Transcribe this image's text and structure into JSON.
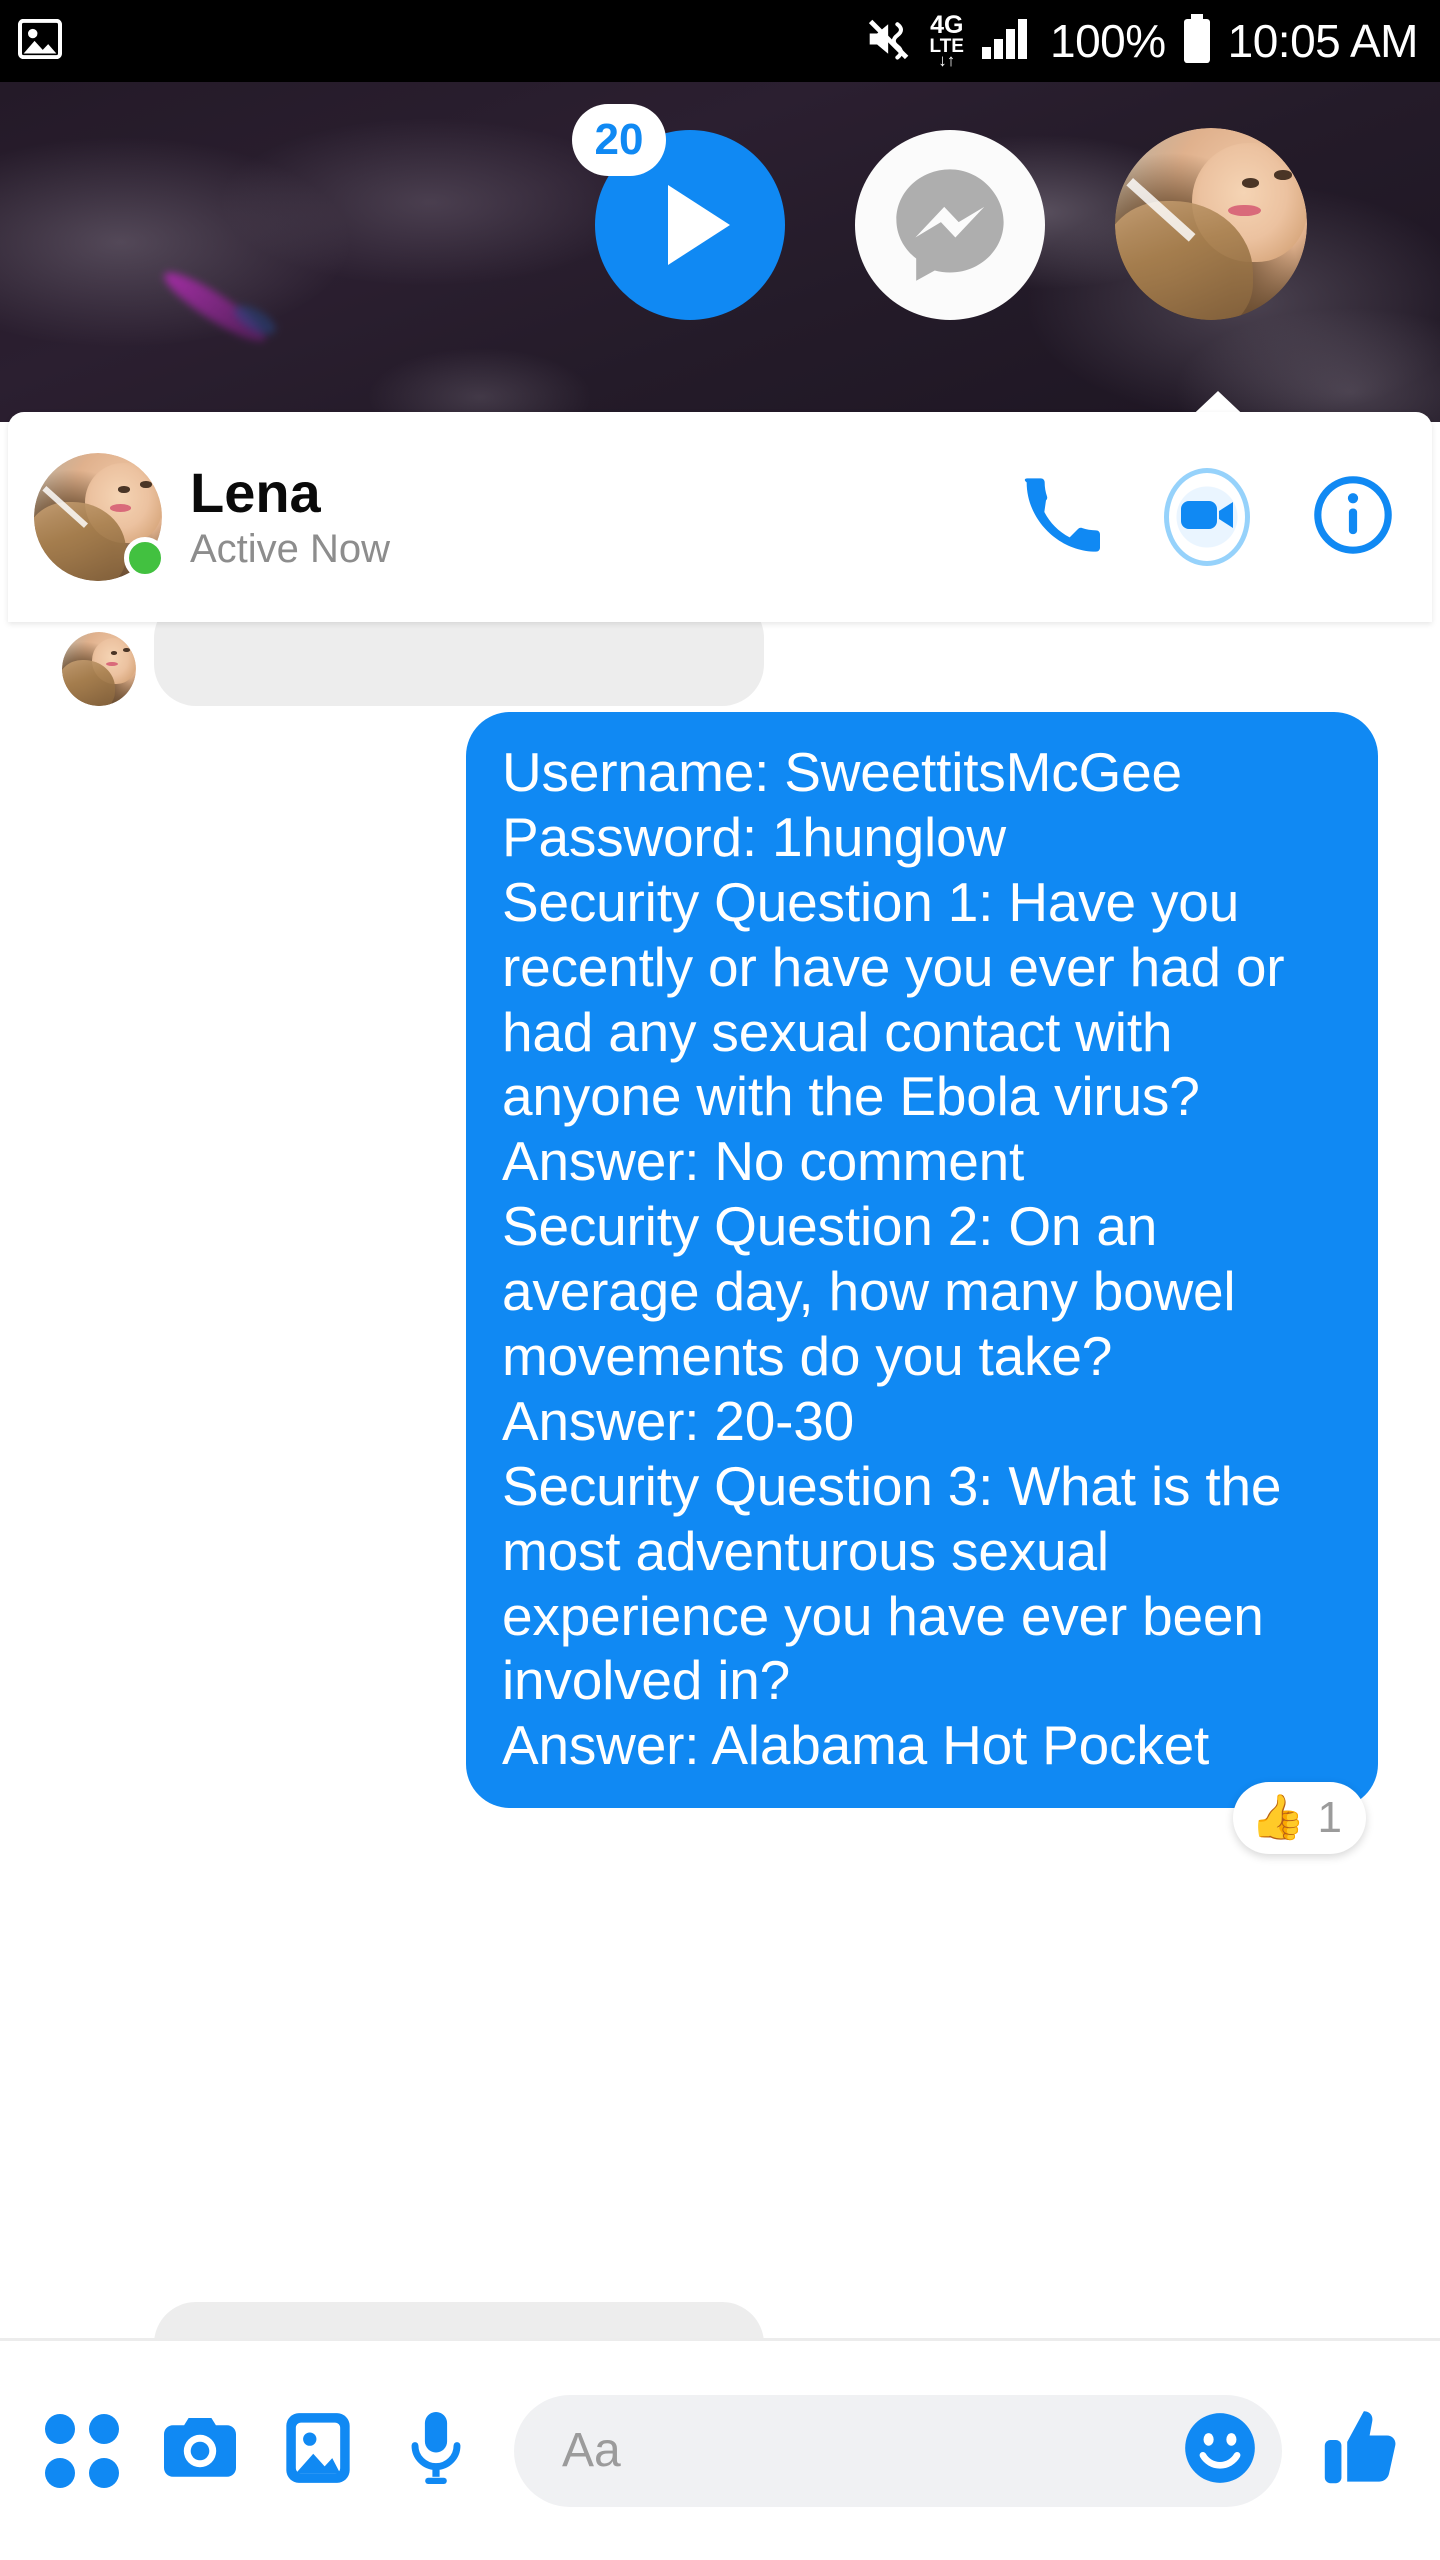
{
  "status_bar": {
    "screenshot_icon": "image-icon",
    "mute_icon": "mute-icon",
    "network_label_top": "4G",
    "network_label_bottom": "LTE",
    "data_arrows": "↓↑",
    "signal_icon": "signal-bars-icon",
    "battery_percent": "100%",
    "battery_icon": "battery-full-icon",
    "clock": "10:05 AM"
  },
  "chat_heads": {
    "play_button": {
      "icon": "play-icon",
      "badge_count": "20",
      "color": "#1089f3"
    },
    "messenger_button": {
      "icon": "messenger-logo-icon",
      "bg": "#fbfbfb",
      "glyph_color": "#aeaeae"
    },
    "contact_head": {
      "icon": "contact-avatar",
      "name": "Lena"
    }
  },
  "conversation_header": {
    "avatar": "lena-avatar",
    "name": "Lena",
    "status": "Active Now",
    "online_color": "#42c140",
    "actions": [
      {
        "name": "voice-call",
        "icon": "phone-icon"
      },
      {
        "name": "video-call",
        "icon": "video-camera-icon"
      },
      {
        "name": "conversation-info",
        "icon": "info-icon"
      }
    ]
  },
  "messages": {
    "incoming_top_placeholder": "",
    "incoming_bottom_placeholder": "",
    "outgoing": {
      "text": "Username: SweettitsMcGee\nPassword: 1hunglow\nSecurity Question 1: Have you recently or have you ever had or had any sexual contact with anyone with the Ebola virus?\nAnswer: No comment\nSecurity Question 2: On an average day, how many bowel movements do you take?\nAnswer: 20-30\nSecurity Question 3: What is the most adventurous sexual experience you have ever been involved in?\nAnswer: Alabama Hot Pocket",
      "bubble_color": "#1089f3",
      "reaction": {
        "emoji": "👍",
        "count": "1"
      }
    }
  },
  "toolbar": {
    "items": [
      {
        "name": "more-apps",
        "icon": "grid-dots-icon"
      },
      {
        "name": "camera",
        "icon": "camera-icon"
      },
      {
        "name": "gallery",
        "icon": "image-icon"
      },
      {
        "name": "voice-record",
        "icon": "microphone-icon"
      }
    ],
    "composer_placeholder": "Aa",
    "emoji_icon": "smiley-icon",
    "like_icon": "thumbs-up-icon",
    "accent_color": "#1089f3"
  }
}
